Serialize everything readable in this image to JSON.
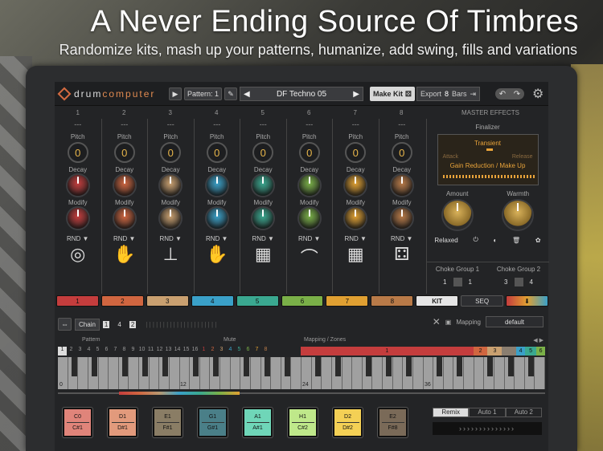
{
  "headline": "A Never Ending Source Of Timbres",
  "subline": "Randomize kits, mash up your patterns, humanize, add swing, fills and variations",
  "app": {
    "logo_a": "drum",
    "logo_b": "computer"
  },
  "topbar": {
    "pattern_label": "Pattern:",
    "pattern_value": "1",
    "kit_name": "DF Techno 05",
    "make_kit": "Make Kit",
    "export_label": "Export",
    "export_value": "8",
    "bars_label": "Bars"
  },
  "channels": [
    {
      "num": "1",
      "dash": "---",
      "pitch_label": "Pitch",
      "pitch": "0",
      "decay_label": "Decay",
      "modify_label": "Modify",
      "rnd": "RND ▼",
      "color": "#c43d3d",
      "icon": "◎"
    },
    {
      "num": "2",
      "dash": "---",
      "pitch_label": "Pitch",
      "pitch": "0",
      "decay_label": "Decay",
      "modify_label": "Modify",
      "rnd": "RND ▼",
      "color": "#d06640",
      "icon": "✋"
    },
    {
      "num": "3",
      "dash": "---",
      "pitch_label": "Pitch",
      "pitch": "0",
      "decay_label": "Decay",
      "modify_label": "Modify",
      "rnd": "RND ▼",
      "color": "#c9a070",
      "icon": "⊥"
    },
    {
      "num": "4",
      "dash": "---",
      "pitch_label": "Pitch",
      "pitch": "0",
      "decay_label": "Decay",
      "modify_label": "Modify",
      "rnd": "RND ▼",
      "color": "#3aa0c8",
      "icon": "✋"
    },
    {
      "num": "5",
      "dash": "---",
      "pitch_label": "Pitch",
      "pitch": "0",
      "decay_label": "Decay",
      "modify_label": "Modify",
      "rnd": "RND ▼",
      "color": "#3aa890",
      "icon": "▦"
    },
    {
      "num": "6",
      "dash": "---",
      "pitch_label": "Pitch",
      "pitch": "0",
      "decay_label": "Decay",
      "modify_label": "Modify",
      "rnd": "RND ▼",
      "color": "#7ab048",
      "icon": "⌒"
    },
    {
      "num": "7",
      "dash": "---",
      "pitch_label": "Pitch",
      "pitch": "0",
      "decay_label": "Decay",
      "modify_label": "Modify",
      "rnd": "RND ▼",
      "color": "#e0a032",
      "icon": "▦"
    },
    {
      "num": "8",
      "dash": "---",
      "pitch_label": "Pitch",
      "pitch": "0",
      "decay_label": "Decay",
      "modify_label": "Modify",
      "rnd": "RND ▼",
      "color": "#b87a48",
      "icon": "⚃"
    }
  ],
  "master": {
    "title": "MASTER EFFECTS",
    "finalizer": "Finalizer",
    "transient": "Transient",
    "attack": "Attack",
    "release": "Release",
    "gain": "Gain Reduction / Make Up",
    "amount": "Amount",
    "warmth": "Warmth",
    "relaxed": "Relaxed",
    "choke1": "Choke Group 1",
    "choke1_a": "1",
    "choke1_b": "1",
    "choke2": "Choke Group 2",
    "choke2_a": "3",
    "choke2_b": "4"
  },
  "padselect": {
    "labels": [
      "1",
      "2",
      "3",
      "4",
      "5",
      "6",
      "7",
      "8"
    ],
    "kit": "KIT",
    "seq": "SEQ"
  },
  "chain": {
    "label": "Chain",
    "values": [
      "1",
      "4",
      "2"
    ],
    "mapping_label": "Mapping",
    "mapping_value": "default"
  },
  "pm": {
    "pattern": "Pattern",
    "mute": "Mute",
    "zones": "Mapping / Zones",
    "arrows": "◀ ▶"
  },
  "pattern_numbers": [
    "1",
    "2",
    "3",
    "4",
    "5",
    "6",
    "7",
    "8",
    "9",
    "10",
    "11",
    "12",
    "13",
    "14",
    "15",
    "16"
  ],
  "mute_numbers": [
    "1",
    "2",
    "3",
    "4",
    "5",
    "6",
    "7",
    "8"
  ],
  "zones": [
    {
      "label": "1",
      "color": "#c43d3d",
      "flex": 12
    },
    {
      "label": "2",
      "color": "#d06640",
      "flex": 1
    },
    {
      "label": "3",
      "color": "#c9a070",
      "flex": 1
    },
    {
      "label": "",
      "color": "#8a7e70",
      "flex": 1
    },
    {
      "label": "4",
      "color": "#3aa0c8",
      "flex": 0.6
    },
    {
      "label": "5",
      "color": "#3aa890",
      "flex": 0.8
    },
    {
      "label": "6",
      "color": "#7ab048",
      "flex": 0.6
    }
  ],
  "piano_labels": [
    "0",
    "12",
    "24",
    "36"
  ],
  "pads": [
    {
      "top": "C0",
      "bottom": "C#1",
      "color": "#e0847a"
    },
    {
      "top": "D1",
      "bottom": "D#1",
      "color": "#e29a7c"
    },
    {
      "top": "E1",
      "bottom": "F#1",
      "color": "#8a7d65"
    },
    {
      "top": "G1",
      "bottom": "G#1",
      "color": "#4a7f88"
    },
    {
      "top": "A1",
      "bottom": "A#1",
      "color": "#6fd6b8"
    },
    {
      "top": "H1",
      "bottom": "C#2",
      "color": "#bfe88a"
    },
    {
      "top": "D2",
      "bottom": "D#2",
      "color": "#f4d055"
    },
    {
      "top": "E2",
      "bottom": "F#8",
      "color": "#7a6a58"
    }
  ],
  "remix": {
    "remix": "Remix",
    "auto1": "Auto 1",
    "auto2": "Auto 2",
    "arrows": "››››››››››››››"
  }
}
